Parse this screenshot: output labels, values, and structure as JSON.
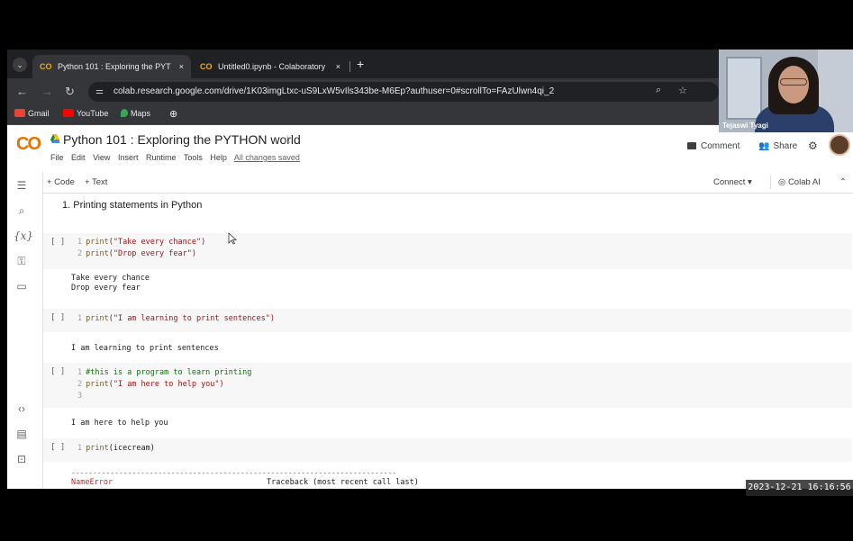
{
  "browser": {
    "tabs": [
      {
        "icon": "CO",
        "title": "Python 101 : Exploring the PYT",
        "close": "×"
      },
      {
        "icon": "CO",
        "title": "Untitled0.ipynb - Colaboratory",
        "close": "×"
      }
    ],
    "new_tab": "+",
    "url": "colab.research.google.com/drive/1K03imgLtxc-uS9LxW5vIls343be-M6Ep?authuser=0#scrollTo=FAzUlwn4qi_2",
    "bookmarks": [
      {
        "label": "Gmail",
        "color": "#ea4335"
      },
      {
        "label": "YouTube",
        "color": "#ff0000"
      },
      {
        "label": "Maps",
        "color": "#34a853"
      }
    ]
  },
  "webcam": {
    "name": "Tejaswi Tyagi"
  },
  "colab": {
    "logo": "CO",
    "title": "Python 101 : Exploring the PYTHON world",
    "menu": [
      "File",
      "Edit",
      "View",
      "Insert",
      "Runtime",
      "Tools",
      "Help"
    ],
    "saved_status": "All changes saved",
    "comment_label": "Comment",
    "share_label": "Share",
    "toolbar": {
      "add_code": "+ Code",
      "add_text": "+ Text",
      "connect": "Connect",
      "colab_ai": "Colab AI"
    }
  },
  "notebook": {
    "heading": "1. Printing statements in Python",
    "cells": [
      {
        "bracket": "[ ]",
        "lines": [
          {
            "n": "1",
            "fn": "print",
            "rest": "(\"Take every chance\")"
          },
          {
            "n": "2",
            "fn": "print",
            "rest": "(\"Drop every fear\")"
          }
        ],
        "output": [
          "Take every chance",
          "Drop every fear"
        ]
      },
      {
        "bracket": "[ ]",
        "lines": [
          {
            "n": "1",
            "fn": "print",
            "rest": "(\"I am learning to print sentences\")"
          }
        ],
        "output": [
          "I am learning to print sentences"
        ]
      },
      {
        "bracket": "[ ]",
        "lines": [
          {
            "n": "1",
            "comment": "#this is a program to learn printing"
          },
          {
            "n": "2",
            "fn": "print",
            "rest": "(\"I am here to help you\")"
          },
          {
            "n": "3"
          }
        ],
        "output": [
          "I am here to help you"
        ]
      },
      {
        "bracket": "[ ]",
        "lines": [
          {
            "n": "1",
            "fn": "print",
            "rest": "(icecream)"
          }
        ],
        "error_name": "NameError",
        "traceback": "Traceback (most recent call last)"
      }
    ]
  },
  "timestamp": "2023-12-21 16:16:56"
}
